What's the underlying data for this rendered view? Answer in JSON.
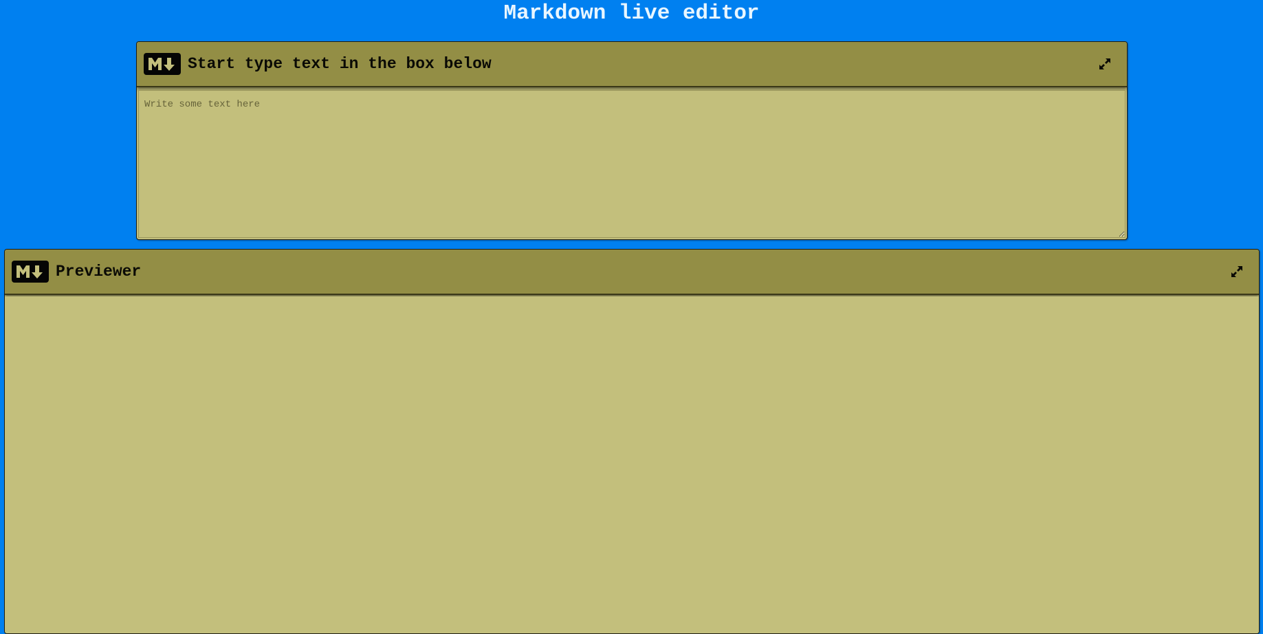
{
  "page": {
    "title": "Markdown live editor",
    "background_color": "#0080f0",
    "panel_color": "#c3bf7c",
    "toolbar_color": "#938e45"
  },
  "editor": {
    "logo_icon": "markdown-logo-icon",
    "toolbar_title": "Start type text in the box below",
    "expand_icon": "expand-arrows-icon",
    "textarea_value": "",
    "textarea_placeholder": "Write some text here"
  },
  "previewer": {
    "logo_icon": "markdown-logo-icon",
    "toolbar_title": "Previewer",
    "expand_icon": "expand-arrows-icon",
    "content": ""
  }
}
